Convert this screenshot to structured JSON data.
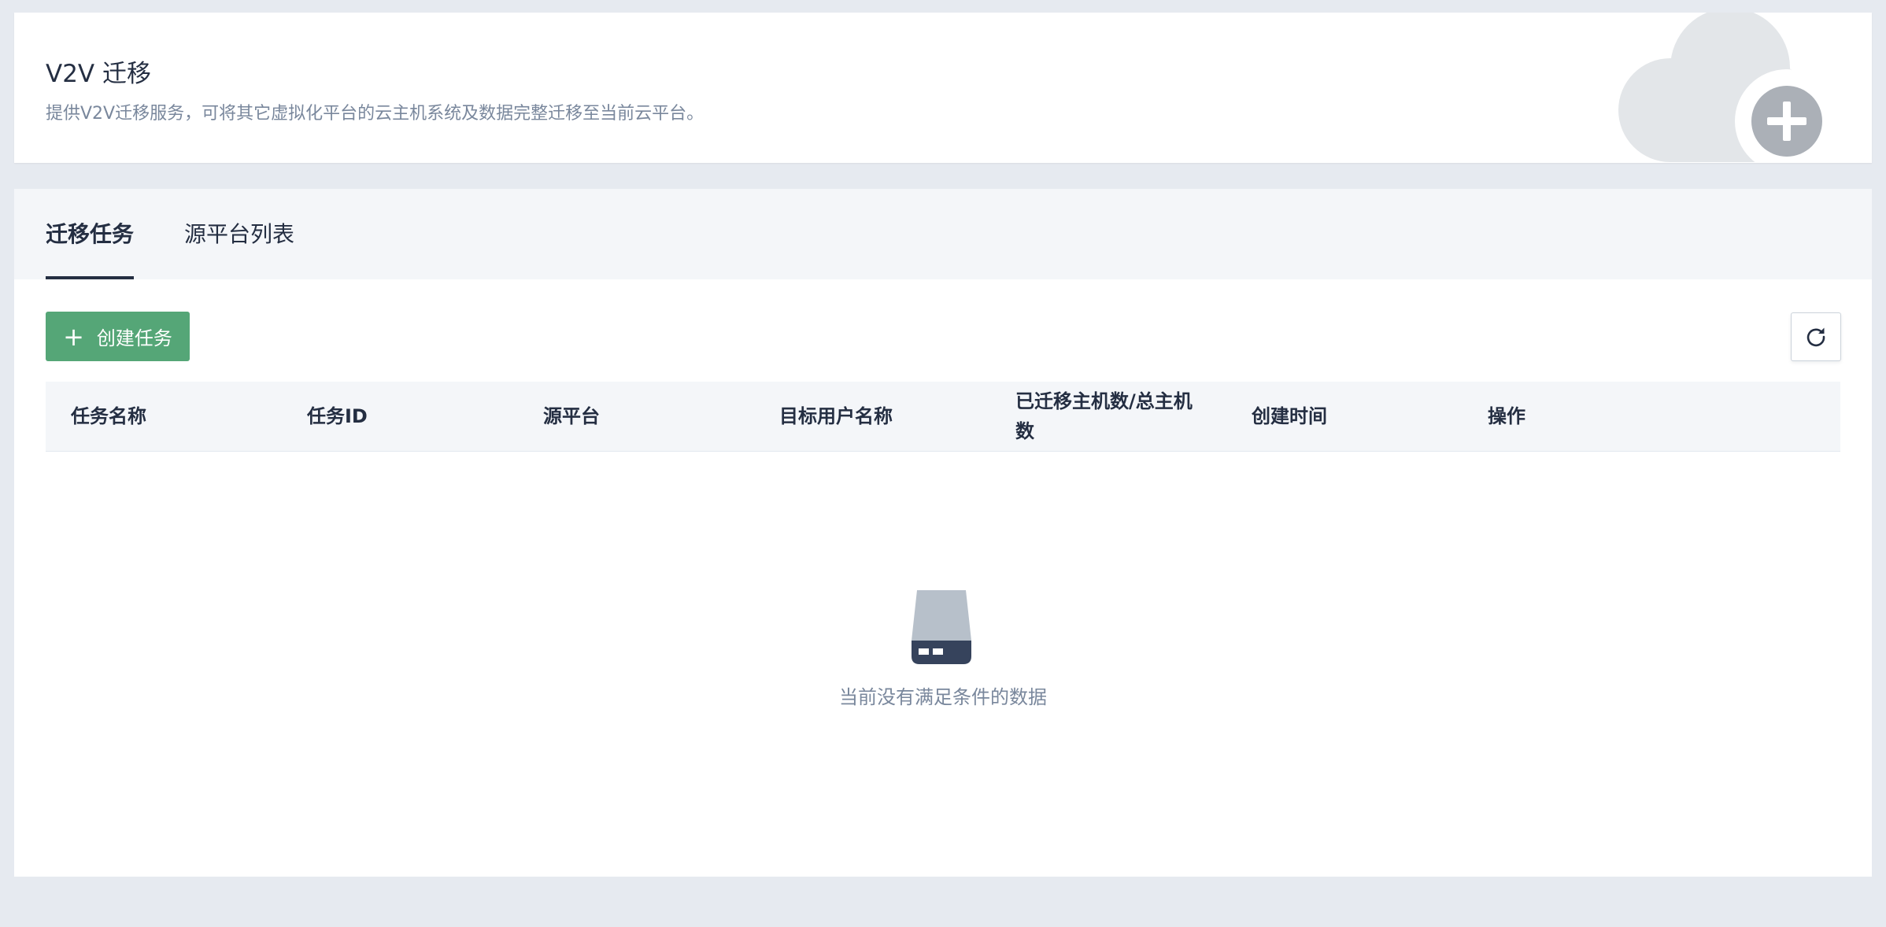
{
  "header": {
    "title": "V2V 迁移",
    "description": "提供V2V迁移服务，可将其它虚拟化平台的云主机系统及数据完整迁移至当前云平台。",
    "illustration_icon": "cloud-add-icon"
  },
  "tabs": [
    {
      "label": "迁移任务",
      "active": true
    },
    {
      "label": "源平台列表",
      "active": false
    }
  ],
  "toolbar": {
    "create_icon": "plus-icon",
    "create_label": "创建任务",
    "refresh_icon": "refresh-icon"
  },
  "table": {
    "columns": [
      "任务名称",
      "任务ID",
      "源平台",
      "目标用户名称",
      "已迁移主机数/总主机数",
      "创建时间",
      "操作"
    ],
    "rows": []
  },
  "empty_state": {
    "icon": "disk-icon",
    "text": "当前没有满足条件的数据"
  },
  "colors": {
    "accent_green": "#55a677",
    "text_dark": "#242e42",
    "text_muted": "#79879c",
    "page_bg": "#e6eaf0"
  }
}
